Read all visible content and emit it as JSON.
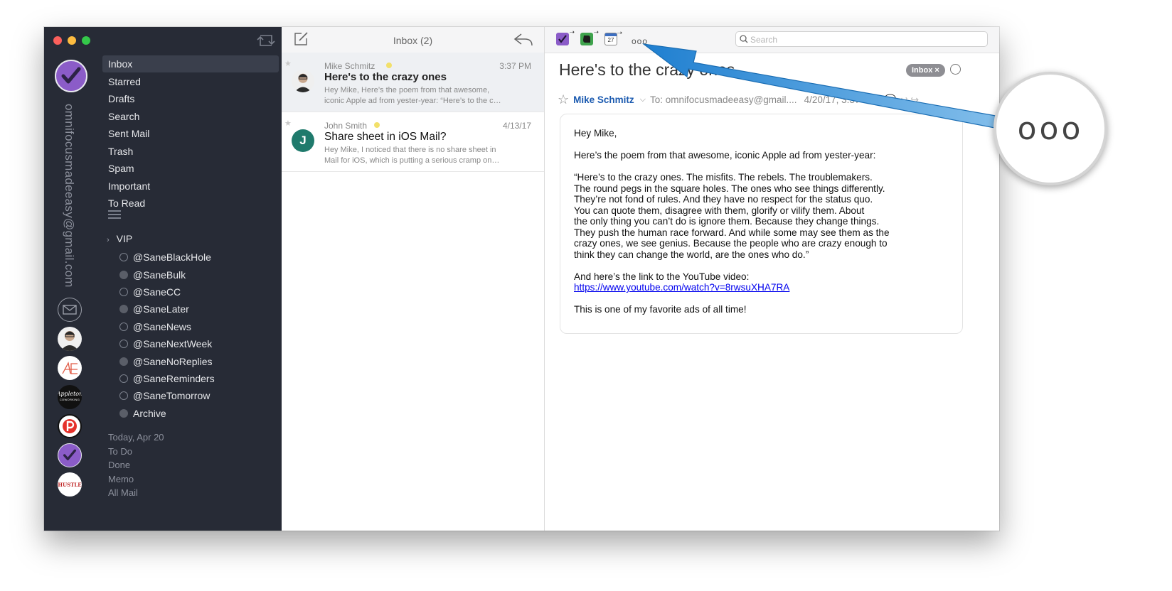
{
  "sidebar": {
    "account_email": "omnifocusmadeeasy@gmail.com",
    "folders": [
      {
        "label": "Inbox",
        "active": true
      },
      {
        "label": "Starred"
      },
      {
        "label": "Drafts"
      },
      {
        "label": "Search"
      },
      {
        "label": "Sent Mail"
      },
      {
        "label": "Trash"
      },
      {
        "label": "Spam"
      },
      {
        "label": "Important"
      },
      {
        "label": "To Read"
      }
    ],
    "vip_label": "VIP",
    "labels": [
      {
        "label": "@SaneBlackHole",
        "filled": false
      },
      {
        "label": "@SaneBulk",
        "filled": true
      },
      {
        "label": "@SaneCC",
        "filled": false
      },
      {
        "label": "@SaneLater",
        "filled": true
      },
      {
        "label": "@SaneNews",
        "filled": false
      },
      {
        "label": "@SaneNextWeek",
        "filled": false
      },
      {
        "label": "@SaneNoReplies",
        "filled": true
      },
      {
        "label": "@SaneReminders",
        "filled": false
      },
      {
        "label": "@SaneTomorrow",
        "filled": false
      },
      {
        "label": "Archive",
        "filled": true
      }
    ],
    "smart_items": [
      "Today, Apr 20",
      "To Do",
      "Done",
      "Memo",
      "All Mail"
    ],
    "account_avatars": [
      "envelope-icon",
      "profile-photo",
      "ae-logo",
      "appleton-coworking-logo",
      "p-logo",
      "purple-check-logo",
      "hustle-logo"
    ],
    "avatar_text": {
      "appleton_top": "Appleton",
      "appleton_bottom": "COWORKING",
      "hustle": "HUSTLE"
    }
  },
  "list": {
    "title": "Inbox (2)",
    "messages": [
      {
        "sender": "Mike Schmitz",
        "date": "3:37 PM",
        "subject": "Here's to the crazy ones",
        "preview": "Hey Mike, Here’s the poem from that awesome, iconic Apple ad from yester-year: “Here’s to the c…",
        "selected": true
      },
      {
        "sender": "John Smith",
        "initial": "J",
        "date": "4/13/17",
        "subject": "Share sheet in iOS Mail?",
        "preview": "Hey Mike, I noticed that there is no share sheet in Mail for iOS, which is putting a serious cramp on…",
        "selected": false
      }
    ]
  },
  "reader": {
    "toolbar": {
      "search_placeholder": "Search",
      "calendar_day": "27",
      "more_glyph": "ooo"
    },
    "subject": "Here's to the crazy ones",
    "tag": "Inbox ×",
    "sender": "Mike Schmitz",
    "recipient": "To: omnifocusmadeeasy@gmail....",
    "date": "4/20/17, 3:37 PM",
    "body": {
      "greeting": "Hey Mike,",
      "intro": "Here’s the poem from that awesome, iconic Apple ad from yester-year:",
      "poem_lines": [
        "“Here’s to the crazy ones. The misfits. The rebels. The troublemakers.",
        "The round pegs in the square holes. The ones who see things differently.",
        "They’re not fond of rules. And they have no respect for the status quo.",
        "You can quote them, disagree with them, glorify or vilify them. About",
        "the only thing you can’t do is ignore them. Because they change things.",
        "They push the human race forward. And while some may see them as the",
        "crazy ones, we see genius. Because the people who are crazy enough to",
        "think they can change the world, are the ones who do.”"
      ],
      "link_intro": "And here’s the link to the YouTube video:",
      "link": "https://www.youtube.com/watch?v=8rwsuXHA7RA",
      "closing": "This is one of my favorite ads of all time!"
    }
  },
  "callout": {
    "zoom_glyph": "ooo",
    "arrow_color": "#2b8fd6"
  }
}
